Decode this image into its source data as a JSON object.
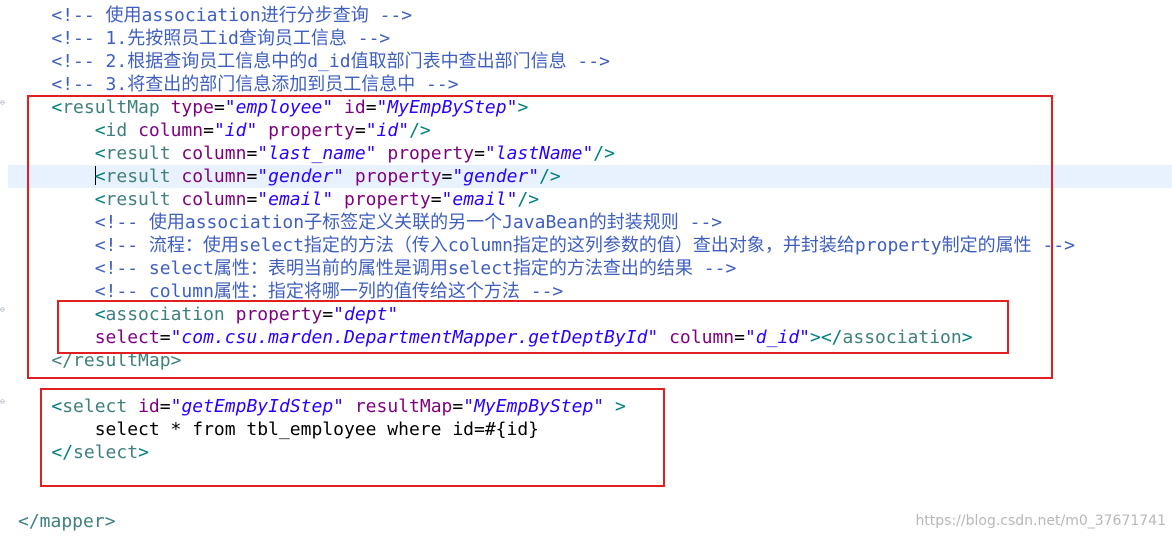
{
  "code": {
    "comments": {
      "c1": "<!-- 使用association进行分步查询 -->",
      "c2": "<!-- 1.先按照员工id查询员工信息 -->",
      "c3": "<!-- 2.根据查询员工信息中的d_id值取部门表中查出部门信息 -->",
      "c4": "<!-- 3.将查出的部门信息添加到员工信息中 -->",
      "c5": "<!-- 使用association子标签定义关联的另一个JavaBean的封装规则 -->",
      "c6": "<!-- 流程：使用select指定的方法（传入column指定的这列参数的值）查出对象，并封装给property制定的属性 -->",
      "c7": "<!-- select属性：表明当前的属性是调用select指定的方法查出的结果 -->",
      "c8": "<!-- column属性：指定将哪一列的值传给这个方法 -->"
    },
    "resultMap": {
      "tag": "resultMap",
      "type_attr": "type",
      "type_value": "\"employee\"",
      "id_attr": "id",
      "id_value": "\"MyEmpByStep\"",
      "close": "</resultMap>"
    },
    "id_line": {
      "tag": "id",
      "column_attr": "column",
      "column_value": "\"id\"",
      "property_attr": "property",
      "property_value": "\"id\""
    },
    "result1": {
      "tag": "result",
      "column_attr": "column",
      "column_value": "\"last_name\"",
      "property_attr": "property",
      "property_value": "\"lastName\""
    },
    "result2": {
      "tag": "result",
      "column_attr": "column",
      "column_value": "\"gender\"",
      "property_attr": "property",
      "property_value": "\"gender\""
    },
    "result3": {
      "tag": "result",
      "column_attr": "column",
      "column_value": "\"email\"",
      "property_attr": "property",
      "property_value": "\"email\""
    },
    "association": {
      "tag": "association",
      "property_attr": "property",
      "property_value": "\"dept\"",
      "select_attr": "select",
      "select_value": "\"com.csu.marden.DepartmentMapper.getDeptById\"",
      "column_attr": "column",
      "column_value": "\"d_id\"",
      "close_tag": "association"
    },
    "select": {
      "tag": "select",
      "id_attr": "id",
      "id_value": "\"getEmpByIdStep\"",
      "resultMap_attr": "resultMap",
      "resultMap_value": "\"MyEmpByStep\"",
      "sql": "select * from tbl_employee where id=#{id}",
      "close_tag": "select"
    },
    "mapper_close": "</mapper>"
  },
  "watermark": "https://blog.csdn.net/m0_37671741",
  "colors": {
    "comment": "#3f5fbf",
    "tag": "#3f7f7f",
    "attribute": "#7f007f",
    "value": "#2a00ff",
    "highlight_box": "#e02020",
    "current_line": "#e8f2fe"
  }
}
